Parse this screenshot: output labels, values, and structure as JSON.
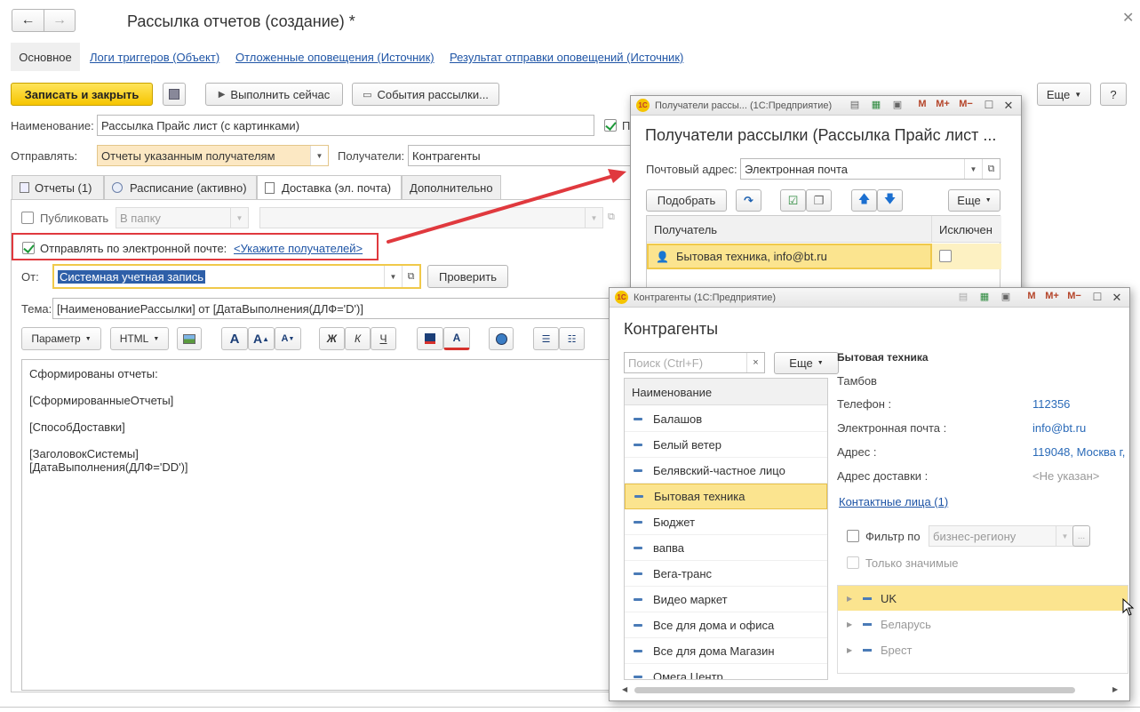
{
  "window": {
    "title": "Рассылка отчетов (создание) *",
    "nav_tabs": [
      "Основное",
      "Логи триггеров (Объект)",
      "Отложенные оповещения (Источник)",
      "Результат отправки оповещений (Источник)"
    ]
  },
  "toolbar": {
    "save_close": "Записать и закрыть",
    "run_now": "Выполнить сейчас",
    "events": "События рассылки...",
    "more": "Еще",
    "help": "?"
  },
  "form": {
    "name_label": "Наименование:",
    "name_value": "Рассылка Прайс лист (с картинками)",
    "checkbox_p": "П",
    "send_label": "Отправлять:",
    "send_value": "Отчеты указанным получателям",
    "recipients_label": "Получатели:",
    "recipients_value": "Контрагенты"
  },
  "tabs": [
    "Отчеты (1)",
    "Расписание (активно)",
    "Доставка (эл. почта)",
    "Дополнительно"
  ],
  "delivery": {
    "publish_label": "Публиковать",
    "folder_placeholder": "В папку",
    "send_email_label": "Отправлять по электронной почте:",
    "specify_recipients_link": "<Укажите получателей>",
    "from_label": "От:",
    "from_value": "Системная учетная запись",
    "check_button": "Проверить",
    "subject_label": "Тема:",
    "subject_value": "[НаименованиеРассылки] от [ДатаВыполнения(ДЛФ='D')]",
    "param_button": "Параметр",
    "html_button": "HTML",
    "body_lines": [
      "Сформированы отчеты:",
      "",
      "[СформированныеОтчеты]",
      "",
      "[СпособДоставки]",
      "",
      "[ЗаголовокСистемы]",
      "[ДатаВыполнения(ДЛФ='DD')]"
    ]
  },
  "recipients_window": {
    "titlebar": "Получатели рассы...  (1С:Предприятие)",
    "heading": "Получатели рассылки (Рассылка Прайс лист ...",
    "email_label": "Почтовый адрес:",
    "email_value": "Электронная почта",
    "pick_button": "Подобрать",
    "more": "Еще",
    "col_recipient": "Получатель",
    "col_excluded": "Исключен",
    "row_recipient": "Бытовая техника, info@bt.ru"
  },
  "contractors_window": {
    "titlebar": "Контрагенты  (1С:Предприятие)",
    "heading": "Контрагенты",
    "search_placeholder": "Поиск (Ctrl+F)",
    "more": "Еще",
    "col_name": "Наименование",
    "items": [
      "Балашов",
      "Белый ветер",
      "Белявский-частное лицо",
      "Бытовая техника",
      "Бюджет",
      "вапва",
      "Вега-транс",
      "Видео маркет",
      "Все для дома и офиса",
      "Все для дома Магазин",
      "Омега Центр"
    ],
    "selected_index": 3,
    "details": {
      "name": "Бытовая техника",
      "city": "Тамбов",
      "phone_label": "Телефон :",
      "phone_value": "112356",
      "email_label": "Электронная почта :",
      "email_value": "info@bt.ru",
      "address_label": "Адрес :",
      "address_value": "119048, Москва г,",
      "delivery_label": "Адрес доставки :",
      "delivery_value": "<Не указан>",
      "contacts_link": "Контактные лица (1)",
      "filter_label": "Фильтр по",
      "filter_value": "бизнес-региону",
      "only_significant": "Только значимые",
      "tree": [
        "UK",
        "Беларусь",
        "Брест"
      ]
    }
  },
  "colors": {
    "accent_yellow": "#f6c500",
    "highlight_row": "#fbe48f",
    "link_blue": "#1f55a6",
    "annotation_red": "#e0393e"
  }
}
